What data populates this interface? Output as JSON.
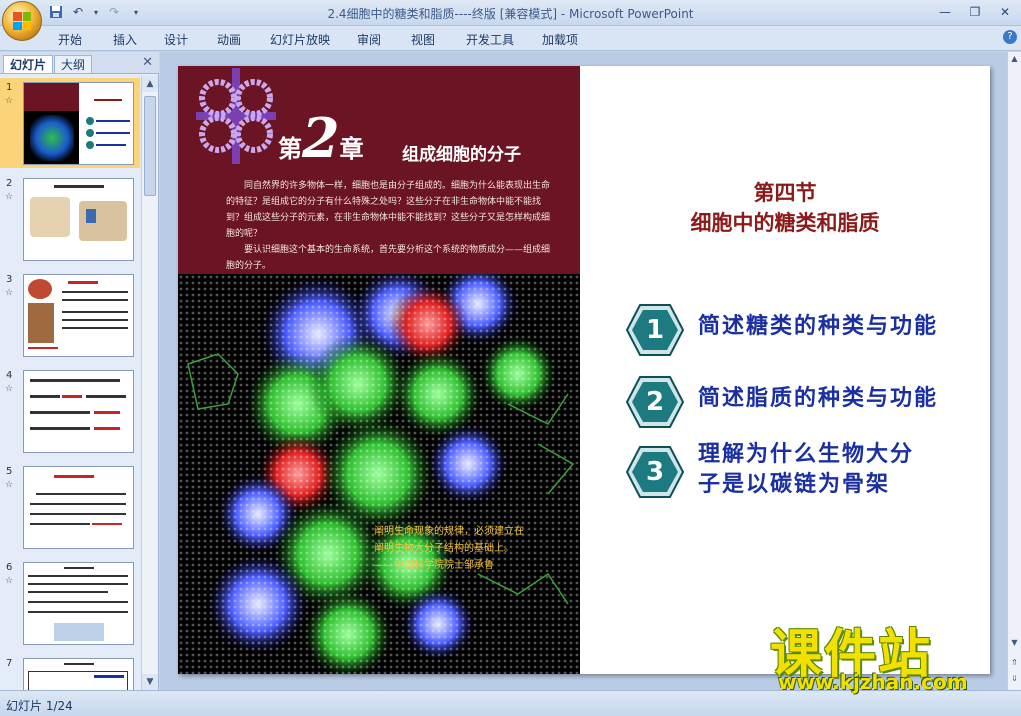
{
  "window": {
    "title": "2.4细胞中的糖类和脂质----终版 [兼容模式] - Microsoft PowerPoint"
  },
  "ribbon": {
    "tabs": [
      "开始",
      "插入",
      "设计",
      "动画",
      "幻灯片放映",
      "审阅",
      "视图",
      "开发工具",
      "加载项"
    ]
  },
  "panel": {
    "tab_slides": "幻灯片",
    "tab_outline": "大纲",
    "thumbnails": [
      {
        "num": "1",
        "star": "☆"
      },
      {
        "num": "2",
        "star": "☆"
      },
      {
        "num": "3",
        "star": "☆"
      },
      {
        "num": "4",
        "star": "☆"
      },
      {
        "num": "5",
        "star": "☆"
      },
      {
        "num": "6",
        "star": "☆"
      },
      {
        "num": "7",
        "star": ""
      }
    ]
  },
  "slide": {
    "chapter_prefix": "第",
    "chapter_num": "2",
    "chapter_suffix": "章",
    "chapter_title": "组成细胞的分子",
    "intro_p1": "同自然界的许多物体一样，细胞也是由分子组成的。细胞为什么能表现出生命的特征？是组成它的分子有什么特殊之处吗？这些分子在非生命物体中能不能找到？组成这些分子的元素，在非生命物体中能不能找到？这些分子又是怎样构成细胞的呢？",
    "intro_p2": "要认识细胞这个基本的生命系统，首先要分析这个系统的物质成分——组成细胞的分子。",
    "quote_line1": "阐明生命现象的规律，必须建立在",
    "quote_line2": "阐明生物大分子结构的基础上。",
    "quote_line3": "——中国科学院院士邹承鲁",
    "section": "第四节",
    "section_title": "细胞中的糖类和脂质",
    "objectives": [
      {
        "num": "1",
        "text": "简述糖类的种类与功能"
      },
      {
        "num": "2",
        "text": "简述脂质的种类与功能"
      },
      {
        "num": "3",
        "line1": "理解为什么生物大分",
        "line2": "子是以碳链为骨架"
      }
    ]
  },
  "status": {
    "slide_counter": "幻灯片 1/24"
  },
  "watermark": {
    "main": "课件站",
    "url": "www.kjzhan.com"
  },
  "colors": {
    "maroon": "#6b1424",
    "section_red": "#8b1a1a",
    "objective_blue": "#1a2fa0",
    "hex_teal": "#1d7a80",
    "selection": "#fbd47a"
  }
}
